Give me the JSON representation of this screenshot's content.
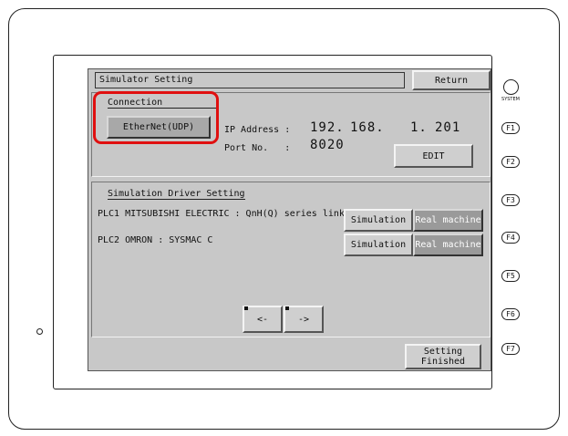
{
  "header": {
    "title": "Simulator Setting",
    "return_label": "Return"
  },
  "connection": {
    "section_label": "Connection",
    "type_button": "EtherNet(UDP)",
    "ip_label": "IP Address :",
    "ip_parts": [
      "192.",
      "168.",
      "1.",
      "201"
    ],
    "port_label": "Port No.   :",
    "port_value": "8020",
    "edit_label": "EDIT"
  },
  "driver": {
    "section_label": "Simulation Driver Setting",
    "plcs": [
      {
        "name": "PLC1 MITSUBISHI ELECTRIC : QnH(Q) series link",
        "sim_label": "Simulation",
        "real_label": "Real machine",
        "selected": "Real machine"
      },
      {
        "name": "PLC2 OMRON : SYSMAC C",
        "sim_label": "Simulation",
        "real_label": "Real machine",
        "selected": "Real machine"
      }
    ],
    "prev_label": "<-",
    "next_label": "->"
  },
  "footer": {
    "finished_label": "Setting\nFinished"
  },
  "side": {
    "system_label": "SYSTEM",
    "fkeys": [
      "F1",
      "F2",
      "F3",
      "F4",
      "F5",
      "F6",
      "F7"
    ]
  },
  "colors": {
    "highlight": "#e01010",
    "screen_bg": "#c8c8c8",
    "selected_btn": "#9a9a9a"
  }
}
